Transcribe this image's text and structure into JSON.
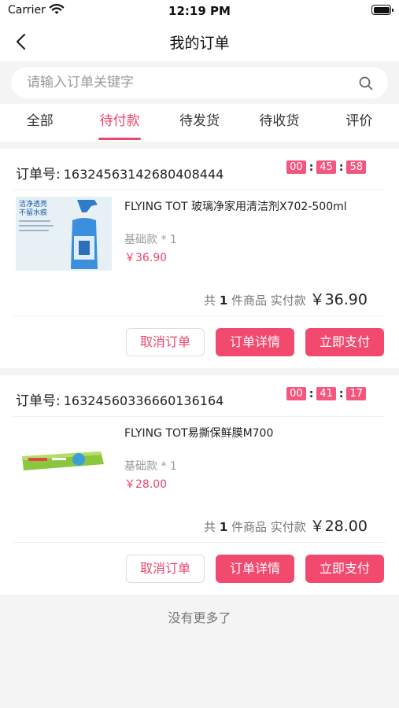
{
  "status_bar": {
    "carrier": "Carrier",
    "time": "12:19 PM"
  },
  "nav": {
    "title": "我的订单"
  },
  "search": {
    "placeholder": "请输入订单关键字"
  },
  "tabs": [
    {
      "label": "全部",
      "active": false
    },
    {
      "label": "待付款",
      "active": true
    },
    {
      "label": "待发货",
      "active": false
    },
    {
      "label": "待收货",
      "active": false
    },
    {
      "label": "评价",
      "active": false
    }
  ],
  "orders": [
    {
      "order_no_label": "订单号:",
      "order_no": "16324563142680408444",
      "countdown": [
        "00",
        "45",
        "58"
      ],
      "product": {
        "name": "FLYING TOT 玻璃净家用清洁剂X702-500ml",
        "spec": "基础款 * 1",
        "price": "￥36.90",
        "image_text": [
          "洁净透亮",
          "不留水痕"
        ]
      },
      "summary": {
        "prefix": "共",
        "count": "1",
        "middle": "件商品 实付款",
        "total": "￥36.90"
      },
      "buttons": {
        "cancel": "取消订单",
        "detail": "订单详情",
        "pay": "立即支付"
      }
    },
    {
      "order_no_label": "订单号:",
      "order_no": "16324560336660136164",
      "countdown": [
        "00",
        "41",
        "17"
      ],
      "product": {
        "name": "FLYING TOT易撕保鲜膜M700",
        "spec": "基础款 * 1",
        "price": "￥28.00"
      },
      "summary": {
        "prefix": "共",
        "count": "1",
        "middle": "件商品 实付款",
        "total": "￥28.00"
      },
      "buttons": {
        "cancel": "取消订单",
        "detail": "订单详情",
        "pay": "立即支付"
      }
    }
  ],
  "footer": {
    "no_more": "没有更多了"
  },
  "colors": {
    "accent": "#f0456a",
    "button": "#f24a6f",
    "background": "#f4f4f4"
  },
  "icons": {
    "back": "chevron-left-icon",
    "search": "search-icon",
    "wifi": "wifi-icon",
    "battery": "battery-icon"
  }
}
